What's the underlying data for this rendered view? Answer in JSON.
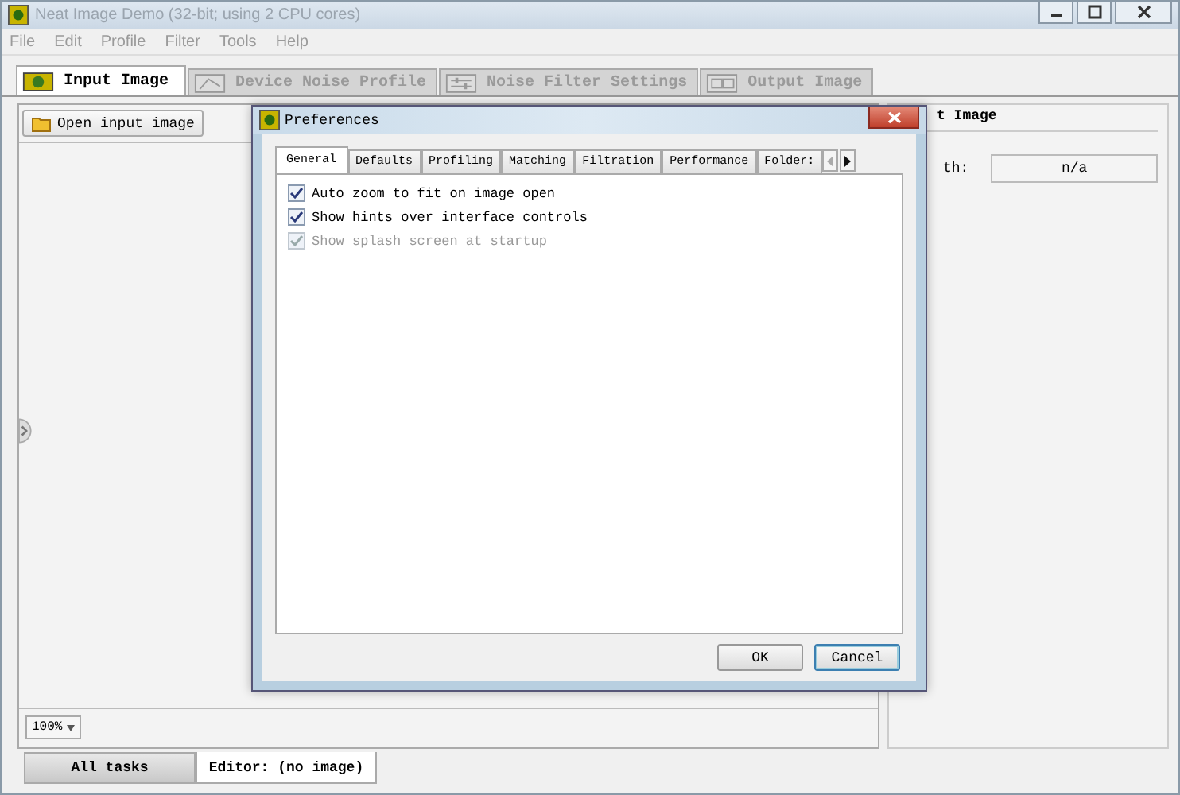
{
  "window": {
    "title": "Neat Image Demo (32-bit; using 2 CPU cores)"
  },
  "menu": [
    {
      "label": "File",
      "disabled": true
    },
    {
      "label": "Edit",
      "disabled": true
    },
    {
      "label": "Profile",
      "disabled": true
    },
    {
      "label": "Filter",
      "disabled": true
    },
    {
      "label": "Tools",
      "disabled": true
    },
    {
      "label": "Help",
      "disabled": true
    }
  ],
  "tabs": [
    {
      "label": "Input Image",
      "selected": true,
      "disabled": false,
      "kind": "image"
    },
    {
      "label": "Device Noise Profile",
      "selected": false,
      "disabled": true,
      "kind": "profile"
    },
    {
      "label": "Noise Filter Settings",
      "selected": false,
      "disabled": true,
      "kind": "sliders"
    },
    {
      "label": "Output Image",
      "selected": false,
      "disabled": true,
      "kind": "output"
    }
  ],
  "input_panel": {
    "open_button": "Open input image",
    "zoom": "100%"
  },
  "info_panel": {
    "heading": "t Image",
    "row_label": "th:",
    "row_value": "n/a"
  },
  "bottom_tabs": [
    {
      "label": "All tasks",
      "selected": false
    },
    {
      "label": "Editor: (no image)",
      "selected": true
    }
  ],
  "dialog": {
    "title": "Preferences",
    "tabs": [
      {
        "label": "General",
        "selected": true
      },
      {
        "label": "Defaults",
        "selected": false
      },
      {
        "label": "Profiling",
        "selected": false
      },
      {
        "label": "Matching",
        "selected": false
      },
      {
        "label": "Filtration",
        "selected": false
      },
      {
        "label": "Performance",
        "selected": false
      },
      {
        "label": "Folder:",
        "selected": false
      }
    ],
    "options": [
      {
        "label": "Auto zoom to fit on image open",
        "checked": true,
        "disabled": false
      },
      {
        "label": "Show hints over interface controls",
        "checked": true,
        "disabled": false
      },
      {
        "label": "Show splash screen at startup",
        "checked": true,
        "disabled": true
      }
    ],
    "buttons": [
      {
        "label": "OK",
        "kind": "ok"
      },
      {
        "label": "Cancel",
        "kind": "cancel"
      }
    ]
  }
}
